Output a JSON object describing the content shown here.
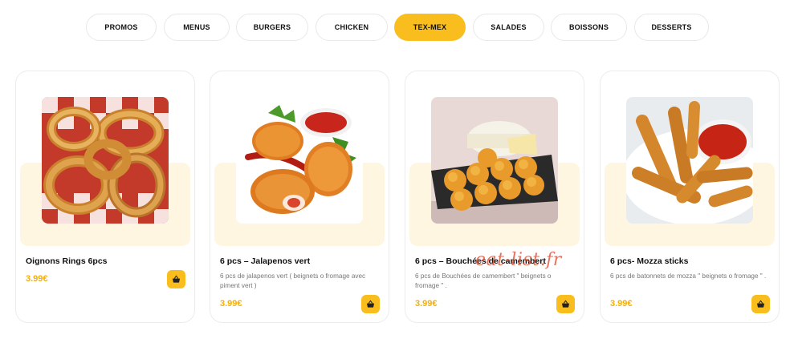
{
  "nav": {
    "categories": [
      "PROMOS",
      "MENUS",
      "BURGERS",
      "CHICKEN",
      "TEX-MEX",
      "SALADES",
      "BOISSONS",
      "DESSERTS"
    ],
    "active": "TEX-MEX"
  },
  "products": [
    {
      "name": "Oignons Rings 6pcs",
      "description": "",
      "price": "3.99€",
      "image_icon": "onion-rings-photo"
    },
    {
      "name": "6 pcs – Jalapenos vert",
      "description": "6 pcs de jalapenos vert ( beignets o fromage avec piment vert )",
      "price": "3.99€",
      "image_icon": "jalapenos-photo"
    },
    {
      "name": "6 pcs – Bouchées de camembert",
      "description": "6 pcs de Bouchées de camembert \" beignets o fromage \" .",
      "price": "3.99€",
      "image_icon": "camembert-bites-photo"
    },
    {
      "name": "6 pcs- Mozza sticks",
      "description": "6 pcs de batonnets de mozza \" beignets o fromage \" .",
      "price": "3.99€",
      "image_icon": "mozza-sticks-photo"
    }
  ],
  "watermark": "eat-list.fr",
  "colors": {
    "accent": "#f9be1e",
    "price": "#f5ae0c",
    "band": "#fef6e0"
  }
}
